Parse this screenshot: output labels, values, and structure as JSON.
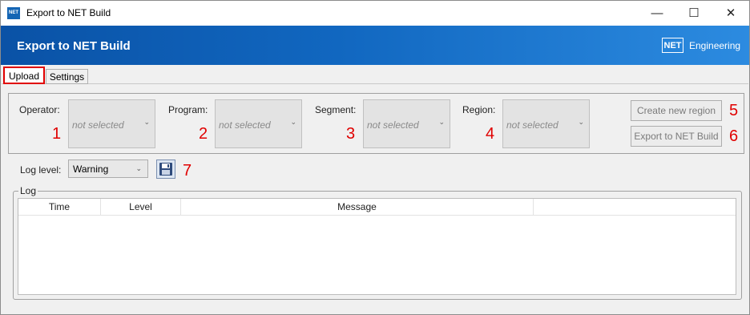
{
  "window": {
    "title": "Export to NET Build",
    "app_icon_text": "NET",
    "minimize_glyph": "—",
    "maximize_glyph": "☐",
    "close_glyph": "✕"
  },
  "header": {
    "title": "Export to NET Build",
    "logo_box": "NET",
    "logo_text": "Engineering",
    "gradient_start": "#0a52a6",
    "gradient_end": "#2c8be0"
  },
  "tabs": [
    {
      "label": "Upload",
      "selected": true
    },
    {
      "label": "Settings",
      "selected": false
    }
  ],
  "filters": {
    "operator": {
      "label": "Operator:",
      "value": "not selected",
      "marker": "1"
    },
    "program": {
      "label": "Program:",
      "value": "not selected",
      "marker": "2"
    },
    "segment": {
      "label": "Segment:",
      "value": "not selected",
      "marker": "3"
    },
    "region": {
      "label": "Region:",
      "value": "not selected",
      "marker": "4"
    }
  },
  "buttons": {
    "create_region": {
      "label": "Create new region",
      "marker": "5"
    },
    "export": {
      "label": "Export to NET Build",
      "marker": "6"
    }
  },
  "log_level": {
    "label": "Log level:",
    "value": "Warning",
    "marker": "7"
  },
  "log": {
    "group_label": "Log",
    "columns": [
      "Time",
      "Level",
      "Message",
      ""
    ]
  },
  "colors": {
    "annotation": "#e00000",
    "accent": "#1167c0"
  },
  "icons": {
    "combo_arrow": "chevron-down-icon",
    "save": "floppy-disk-icon"
  }
}
